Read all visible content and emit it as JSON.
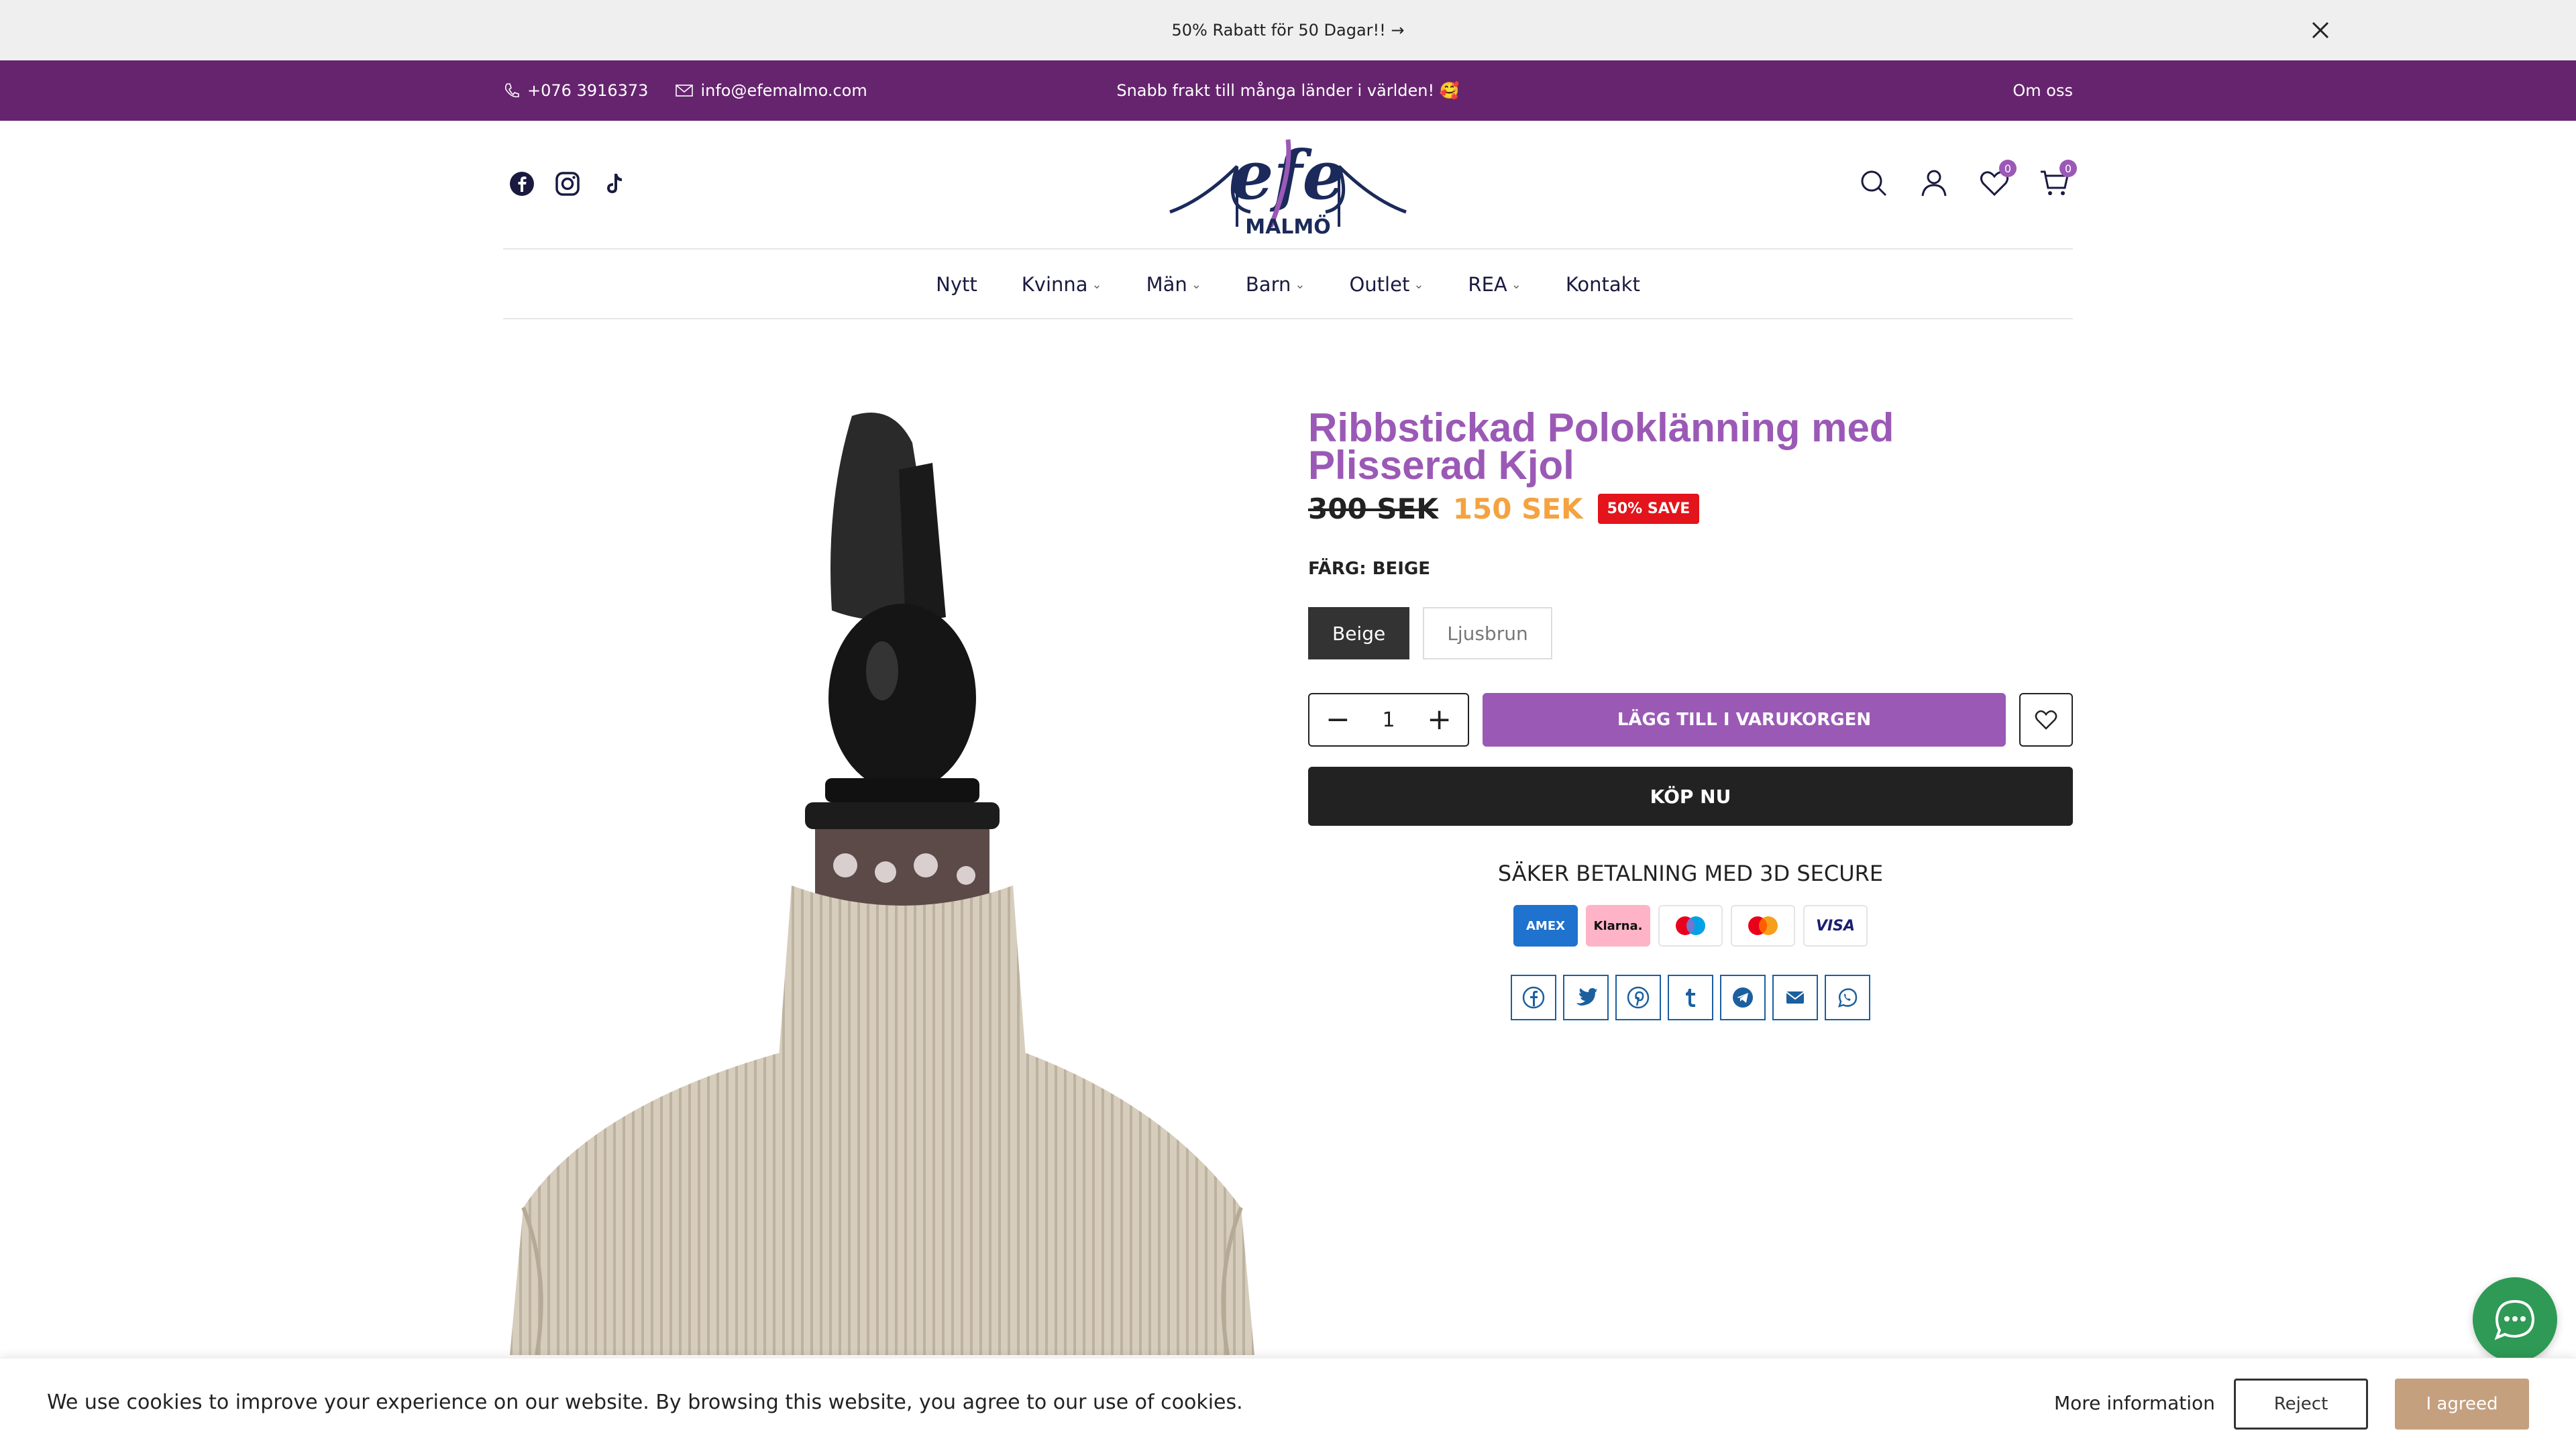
{
  "announcement": {
    "text": "50% Rabatt för 50 Dagar!! →"
  },
  "topbar": {
    "phone": "+076 3916373",
    "email": "info@efemalmo.com",
    "shipping": "Snabb frakt till många länder i världen! 🥰",
    "about": "Om oss"
  },
  "header": {
    "logo_text": "efe",
    "logo_sub": "MALMÖ",
    "wishlist_count": "0",
    "cart_count": "0"
  },
  "nav": {
    "items": [
      {
        "label": "Nytt"
      },
      {
        "label": "Kvinna"
      },
      {
        "label": "Män"
      },
      {
        "label": "Barn"
      },
      {
        "label": "Outlet"
      },
      {
        "label": "REA"
      },
      {
        "label": "Kontakt"
      }
    ]
  },
  "product": {
    "title": "Ribbstickad Poloklänning med Plisserad Kjol",
    "old_price": "300 SEK",
    "new_price": "150 SEK",
    "save_badge": "50% SAVE",
    "color_label": "FÄRG: BEIGE",
    "swatches": [
      "Beige",
      "Ljusbrun"
    ],
    "quantity": "1",
    "add_to_cart": "LÄGG TILL I VARUKORGEN",
    "buy_now": "KÖP NU",
    "secure_text": "SÄKER BETALNING MED 3D SECURE",
    "payments": [
      "AMEX",
      "Klarna.",
      "Maestro",
      "Mastercard",
      "VISA"
    ]
  },
  "cookie": {
    "message": "We use cookies to improve your experience on our website. By browsing this website, you agree to our use of cookies.",
    "more": "More information",
    "reject": "Reject",
    "agree": "I agreed"
  },
  "colors": {
    "brand_purple": "#66246f",
    "accent_purple": "#9b59b6",
    "sale_orange": "#f4a340",
    "save_red": "#e3141b",
    "chat_green": "#2e9a55",
    "agree_tan": "#c5a07f"
  }
}
